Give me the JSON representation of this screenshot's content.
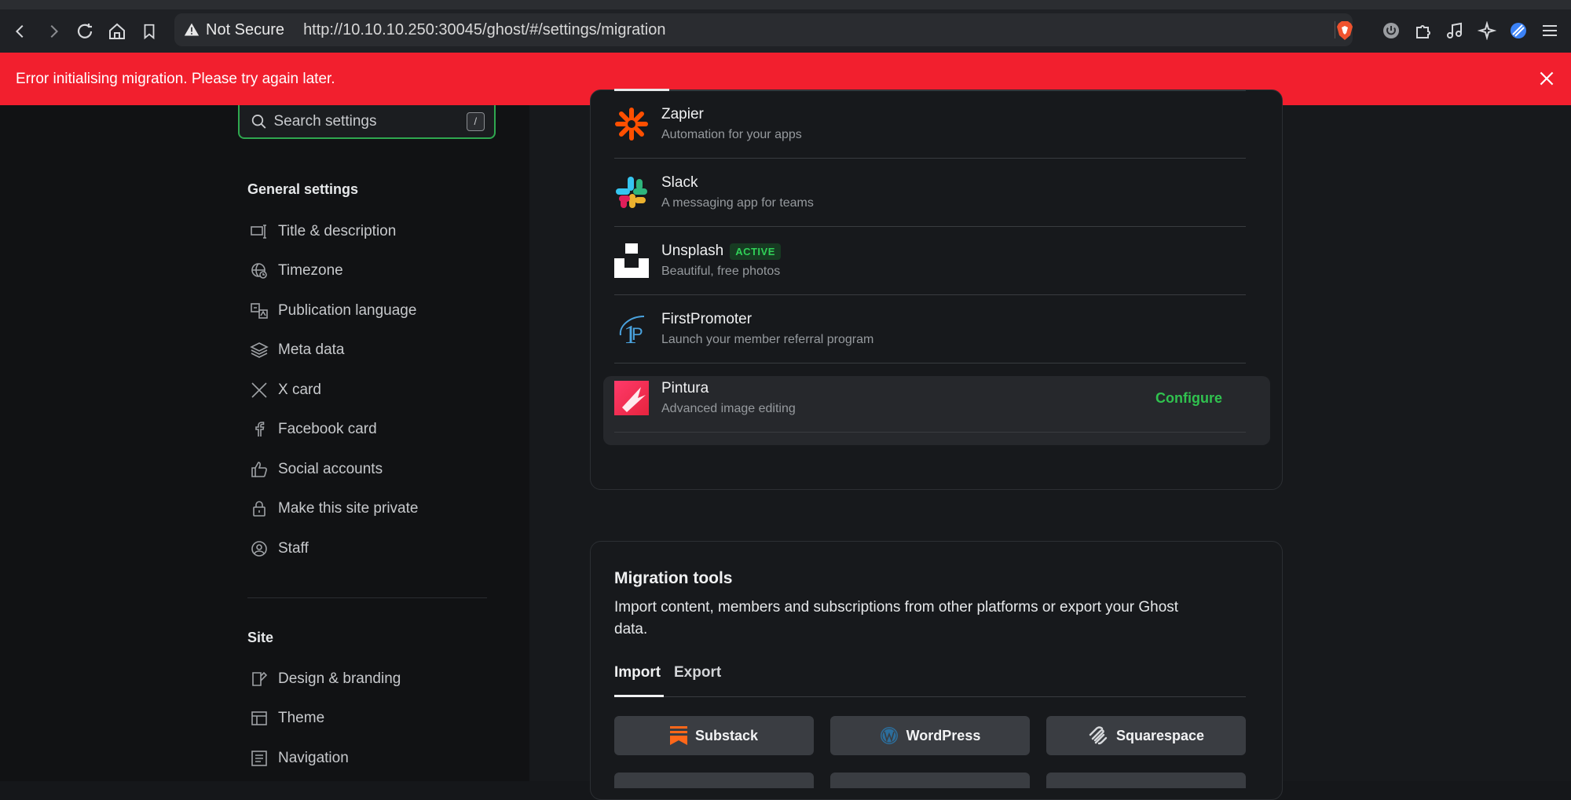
{
  "browser": {
    "security_label": "Not Secure",
    "url": "http://10.10.10.250:30045/ghost/#/settings/migration"
  },
  "banner": {
    "message": "Error initialising migration. Please try again later."
  },
  "sidebar": {
    "search_placeholder": "Search settings",
    "search_shortcut": "/",
    "general_heading": "General settings",
    "general_items": [
      {
        "label": "Title & description",
        "icon": "title-icon"
      },
      {
        "label": "Timezone",
        "icon": "globe-clock-icon"
      },
      {
        "label": "Publication language",
        "icon": "language-icon"
      },
      {
        "label": "Meta data",
        "icon": "layers-icon"
      },
      {
        "label": "X card",
        "icon": "x-icon"
      },
      {
        "label": "Facebook card",
        "icon": "facebook-icon"
      },
      {
        "label": "Social accounts",
        "icon": "thumbs-up-icon"
      },
      {
        "label": "Make this site private",
        "icon": "lock-icon"
      },
      {
        "label": "Staff",
        "icon": "staff-icon"
      }
    ],
    "site_heading": "Site",
    "site_items": [
      {
        "label": "Design & branding",
        "icon": "brush-icon"
      },
      {
        "label": "Theme",
        "icon": "layout-icon"
      },
      {
        "label": "Navigation",
        "icon": "list-icon"
      }
    ]
  },
  "integrations": [
    {
      "name": "Zapier",
      "desc": "Automation for your apps",
      "badge": ""
    },
    {
      "name": "Slack",
      "desc": "A messaging app for teams",
      "badge": ""
    },
    {
      "name": "Unsplash",
      "desc": "Beautiful, free photos",
      "badge": "ACTIVE"
    },
    {
      "name": "FirstPromoter",
      "desc": "Launch your member referral program",
      "badge": ""
    },
    {
      "name": "Pintura",
      "desc": "Advanced image editing",
      "badge": "",
      "action": "Configure"
    }
  ],
  "migration": {
    "title": "Migration tools",
    "description": "Import content, members and subscriptions from other platforms or export your Ghost data.",
    "tabs": [
      "Import",
      "Export"
    ],
    "active_tab": "Import",
    "import_buttons": [
      "Substack",
      "WordPress",
      "Squarespace"
    ]
  },
  "colors": {
    "banner": "#f21f2e",
    "accent_green": "#30c24f",
    "search_border": "#2fa84f"
  }
}
